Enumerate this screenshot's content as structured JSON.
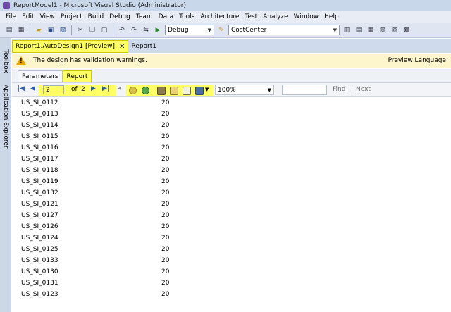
{
  "window": {
    "title": "ReportModel1 - Microsoft Visual Studio (Administrator)"
  },
  "menu": [
    "File",
    "Edit",
    "View",
    "Project",
    "Build",
    "Debug",
    "Team",
    "Data",
    "Tools",
    "Architecture",
    "Test",
    "Analyze",
    "Window",
    "Help"
  ],
  "toolbar": {
    "configuration": "Debug",
    "startup_item": "CostCenter"
  },
  "side_tabs": {
    "toolbox": "Toolbox",
    "app_explorer": "Application Explorer"
  },
  "document_tabs": [
    {
      "label": "Report1.AutoDesign1 [Preview]",
      "active": true
    },
    {
      "label": "Report1",
      "active": false
    }
  ],
  "warning": {
    "message": "The design has validation warnings.",
    "preview_language": "Preview Language:"
  },
  "sub_tabs": [
    {
      "label": "Parameters",
      "active": false
    },
    {
      "label": "Report",
      "active": true
    }
  ],
  "report_toolbar": {
    "current_page": "2",
    "of_label": "of",
    "total_pages": "2",
    "zoom": "100%",
    "find_label": "Find",
    "next_label": "Next",
    "search_value": ""
  },
  "highlight_color": "#ffff66",
  "rows": [
    {
      "name": "US_SI_0112",
      "value": "20"
    },
    {
      "name": "US_SI_0113",
      "value": "20"
    },
    {
      "name": "US_SI_0114",
      "value": "20"
    },
    {
      "name": "US_SI_0115",
      "value": "20"
    },
    {
      "name": "US_SI_0116",
      "value": "20"
    },
    {
      "name": "US_SI_0117",
      "value": "20"
    },
    {
      "name": "US_SI_0118",
      "value": "20"
    },
    {
      "name": "US_SI_0119",
      "value": "20"
    },
    {
      "name": "US_SI_0132",
      "value": "20"
    },
    {
      "name": "US_SI_0121",
      "value": "20"
    },
    {
      "name": "US_SI_0127",
      "value": "20"
    },
    {
      "name": "US_SI_0126",
      "value": "20"
    },
    {
      "name": "US_SI_0124",
      "value": "20"
    },
    {
      "name": "US_SI_0125",
      "value": "20"
    },
    {
      "name": "US_SI_0133",
      "value": "20"
    },
    {
      "name": "US_SI_0130",
      "value": "20"
    },
    {
      "name": "US_SI_0131",
      "value": "20"
    },
    {
      "name": "US_SI_0123",
      "value": "20"
    }
  ]
}
